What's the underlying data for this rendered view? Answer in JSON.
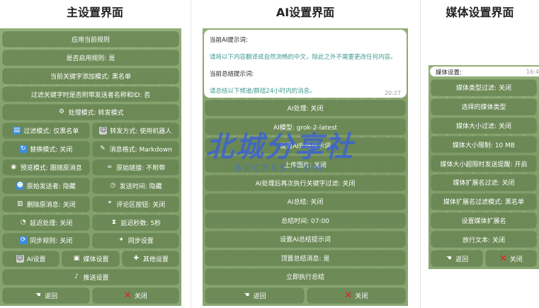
{
  "titles": {
    "main": "主设置界面",
    "ai": "AI设置界面",
    "media": "媒体设置界面"
  },
  "main": {
    "rows": [
      [
        {
          "label": "应用当前规则",
          "icon": null
        }
      ],
      [
        {
          "label": "是否启用规则: 是",
          "icon": null
        }
      ],
      [
        {
          "label": "当前关键字添加模式: 黑名单",
          "icon": null
        }
      ],
      [
        {
          "label": "过滤关键字时是否附带发送者名称和ID: 否",
          "icon": null
        }
      ],
      [
        {
          "label": "处理模式: 转发模式",
          "icon": "gear-icon"
        }
      ],
      [
        {
          "label": "过滤模式: 仅黑名单",
          "icon": "inbox-icon"
        },
        {
          "label": "转发方式: 使用机器人",
          "icon": "robot-icon"
        }
      ],
      [
        {
          "label": "替换模式: 关闭",
          "icon": "refresh-icon"
        },
        {
          "label": "消息格式: Markdown",
          "icon": "memo-icon"
        }
      ],
      [
        {
          "label": "预览模式: 跟随原消息",
          "icon": "eye-icon"
        },
        {
          "label": "原始链接: 不附带",
          "icon": "link-icon"
        }
      ],
      [
        {
          "label": "原始发送者: 隐藏",
          "icon": "person-icon"
        },
        {
          "label": "发送时间: 隐藏",
          "icon": "clock-icon"
        }
      ],
      [
        {
          "label": "删除原消息: 关闭",
          "icon": "trash-icon"
        },
        {
          "label": "评论区按钮: 关闭",
          "icon": "speech-bubble-icon"
        }
      ],
      [
        {
          "label": "延迟处理: 关闭",
          "icon": "stopwatch-icon"
        },
        {
          "label": "延迟秒数: 5秒",
          "icon": "hourglass-icon"
        }
      ],
      [
        {
          "label": "同步规则: 关闭",
          "icon": "sync-icon"
        },
        {
          "label": "同步设置",
          "icon": "satellite-icon"
        }
      ],
      [
        {
          "label": "AI设置",
          "icon": "robot-icon"
        },
        {
          "label": "媒体设置",
          "icon": "clapper-icon"
        },
        {
          "label": "其他设置",
          "icon": "plus-icon"
        }
      ],
      [
        {
          "label": "推送设置",
          "icon": "bell-icon"
        }
      ],
      [
        {
          "label": "返回",
          "icon": "point-left-icon"
        },
        {
          "label": "关闭",
          "icon": "red-x-icon"
        }
      ]
    ]
  },
  "ai": {
    "bubble": {
      "prompt_label": "当前AI提示词:",
      "prompt_text": "请将以下内容翻译成自然流畅的中文，除此之外不需要更改任何内容。",
      "summary_label": "当前总结提示词:",
      "summary_text": "请总结以下频道/群组24小时内的消息。",
      "time": "20:27"
    },
    "rows": [
      [
        {
          "label": "AI处理: 关闭",
          "icon": null
        }
      ],
      [
        {
          "label": "AI模型: grok-2-latest",
          "icon": null
        }
      ],
      [
        {
          "label": "设置AI处理提示词",
          "icon": null
        }
      ],
      [
        {
          "label": "上传图片: 关闭",
          "icon": null
        }
      ],
      [
        {
          "label": "AI处理后再次执行关键字过滤: 关闭",
          "icon": null
        }
      ],
      [
        {
          "label": "AI总结: 关闭",
          "icon": null
        }
      ],
      [
        {
          "label": "总结时间: 07:00",
          "icon": null
        }
      ],
      [
        {
          "label": "设置AI总结提示词",
          "icon": null
        }
      ],
      [
        {
          "label": "顶置总结消息: 是",
          "icon": null
        }
      ],
      [
        {
          "label": "立即执行总结",
          "icon": null
        }
      ],
      [
        {
          "label": "返回",
          "icon": "point-left-icon"
        },
        {
          "label": "关闭",
          "icon": "red-x-icon"
        }
      ]
    ]
  },
  "media": {
    "bubble": {
      "label": "媒体设置:",
      "time": "16:4"
    },
    "rows": [
      [
        {
          "label": "媒体类型过滤: 关闭",
          "icon": null
        }
      ],
      [
        {
          "label": "选择的媒体类型",
          "icon": null
        }
      ],
      [
        {
          "label": "媒体大小过滤: 关闭",
          "icon": null
        }
      ],
      [
        {
          "label": "媒体大小限制: 10 MB",
          "icon": null
        }
      ],
      [
        {
          "label": "媒体大小超限时发送提醒: 开启",
          "icon": null
        }
      ],
      [
        {
          "label": "媒体扩展名过滤: 关闭",
          "icon": null
        }
      ],
      [
        {
          "label": "媒体扩展名过滤模式: 黑名单",
          "icon": null
        }
      ],
      [
        {
          "label": "设置媒体扩展名",
          "icon": null
        }
      ],
      [
        {
          "label": "放行文本: 关闭",
          "icon": null
        }
      ],
      [
        {
          "label": "返回",
          "icon": "point-left-icon"
        },
        {
          "label": "关闭",
          "icon": "red-x-icon"
        }
      ]
    ]
  },
  "watermark": {
    "main": "北城分享社",
    "sub": "BCCFXS.COM"
  }
}
